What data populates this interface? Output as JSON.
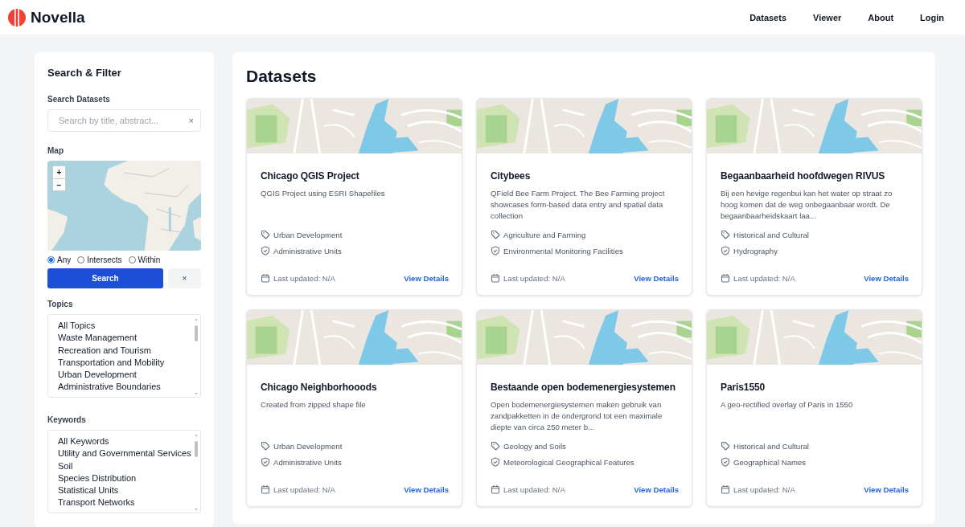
{
  "header": {
    "brand": "Novella",
    "nav": [
      {
        "label": "Datasets"
      },
      {
        "label": "Viewer"
      },
      {
        "label": "About"
      },
      {
        "label": "Login"
      }
    ]
  },
  "sidebar": {
    "title": "Search & Filter",
    "search_label": "Search Datasets",
    "search": {
      "placeholder": "Search by title, abstract...",
      "clear": "×"
    },
    "map_label": "Map",
    "map": {
      "zoom_in": "+",
      "zoom_out": "−"
    },
    "spatial_modes": [
      {
        "label": "Any",
        "selected": true
      },
      {
        "label": "Intersects",
        "selected": false
      },
      {
        "label": "Within",
        "selected": false
      }
    ],
    "search_button": "Search",
    "clear_button": "×",
    "topics_label": "Topics",
    "topics": [
      "All Topics",
      "Waste Management",
      "Recreation and Tourism",
      "Transportation and Mobility",
      "Urban Development",
      "Administrative Boundaries"
    ],
    "keywords_label": "Keywords",
    "keywords": [
      "All Keywords",
      "Utility and Governmental Services",
      "Soil",
      "Species Distribution",
      "Statistical Units",
      "Transport Networks"
    ]
  },
  "main": {
    "title": "Datasets",
    "cards": [
      {
        "title": "Chicago QGIS Project",
        "description": "QGIS Project using ESRI Shapefiles",
        "topic": "Urban Development",
        "keyword": "Administrative Units",
        "updated": "Last updated: N/A",
        "link": "View Details"
      },
      {
        "title": "Citybees",
        "description": "QField Bee Farm Project. The Bee Farming project showcases form-based data entry and spatial data collection",
        "topic": "Agriculture and Farming",
        "keyword": "Environmental Monitoring Facilities",
        "updated": "Last updated: N/A",
        "link": "View Details"
      },
      {
        "title": "Begaanbaarheid hoofdwegen RIVUS",
        "description": "Bij een hevige regenbui kan het water op straat zo hoog komen dat de weg onbegaanbaar wordt. De begaanbaarheidskaart laa...",
        "topic": "Historical and Cultural",
        "keyword": "Hydrography",
        "updated": "Last updated: N/A",
        "link": "View Details"
      },
      {
        "title": "Chicago Neighborhooods",
        "description": "Created from zipped shape file",
        "topic": "Urban Development",
        "keyword": "Administrative Units",
        "updated": "Last updated: N/A",
        "link": "View Details"
      },
      {
        "title": "Bestaande open bodemenergiesystemen",
        "description": "Open bodemenergiesystemen maken gebruik van zandpakketten in de ondergrond tot een maximale diepte van circa 250 meter b...",
        "topic": "Geology and Soils",
        "keyword": "Meteorological Geographical Features",
        "updated": "Last updated: N/A",
        "link": "View Details"
      },
      {
        "title": "Paris1550",
        "description": "A geo-rectified overlay of Paris in 1550",
        "topic": "Historical and Cultural",
        "keyword": "Geographical Names",
        "updated": "Last updated: N/A",
        "link": "View Details"
      }
    ]
  }
}
